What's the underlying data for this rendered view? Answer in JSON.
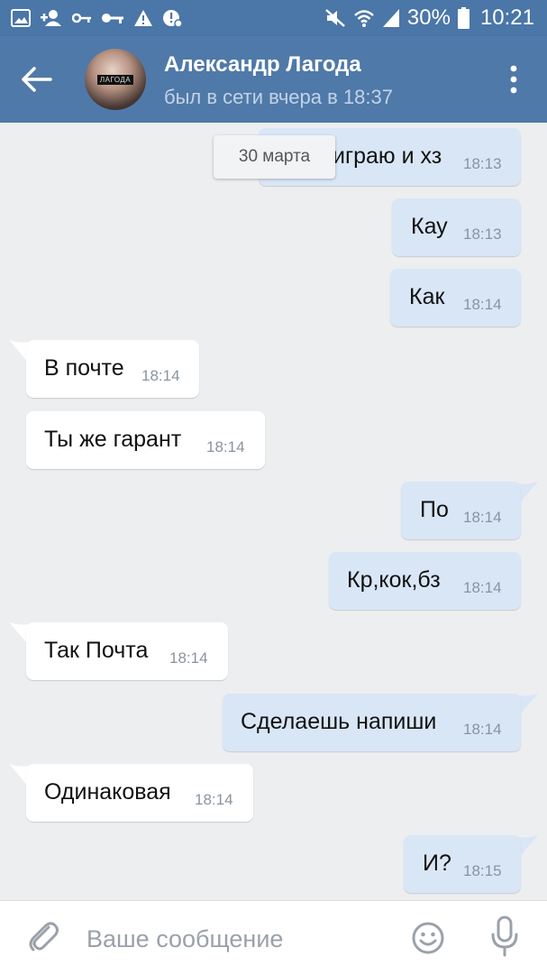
{
  "status_bar": {
    "battery": "30%",
    "time": "10:21",
    "icons": [
      "gallery-icon",
      "add-contact-icon",
      "key-icon",
      "key-icon",
      "warning-icon",
      "alert-icon",
      "mute-icon",
      "wifi-icon",
      "signal-icon",
      "battery-icon"
    ]
  },
  "header": {
    "contact_name": "Александр Лагода",
    "contact_status": "был в сети вчера в 18:37",
    "avatar_tag": "ЛАГОДА",
    "icons": [
      "back-arrow-icon",
      "more-vertical-icon"
    ]
  },
  "chat": {
    "date_label": "30 марта",
    "messages": [
      {
        "direction": "out",
        "text": "играю и хз",
        "time": "18:13"
      },
      {
        "direction": "out",
        "text": "Кау",
        "time": "18:13"
      },
      {
        "direction": "out",
        "text": "Как",
        "time": "18:14"
      },
      {
        "direction": "in",
        "text": "В почте",
        "time": "18:14"
      },
      {
        "direction": "in",
        "text": "Ты же гарант",
        "time": "18:14"
      },
      {
        "direction": "out",
        "text": "По",
        "time": "18:14"
      },
      {
        "direction": "out",
        "text": "Кр,кок,бз",
        "time": "18:14"
      },
      {
        "direction": "in",
        "text": "Так Почта",
        "time": "18:14"
      },
      {
        "direction": "out",
        "text": "Сделаешь напиши",
        "time": "18:14"
      },
      {
        "direction": "in",
        "text": "Одинаковая",
        "time": "18:14"
      },
      {
        "direction": "out",
        "text": "И?",
        "time": "18:15"
      }
    ]
  },
  "composer": {
    "placeholder": "Ваше сообщение",
    "icons": [
      "attach-icon",
      "emoji-icon",
      "microphone-icon"
    ]
  },
  "colors": {
    "header": "#4f79a8",
    "status_bar": "#4a76a8",
    "chat_background": "#edeef0",
    "outgoing_bubble": "#d9e6f6",
    "incoming_bubble": "#ffffff"
  }
}
